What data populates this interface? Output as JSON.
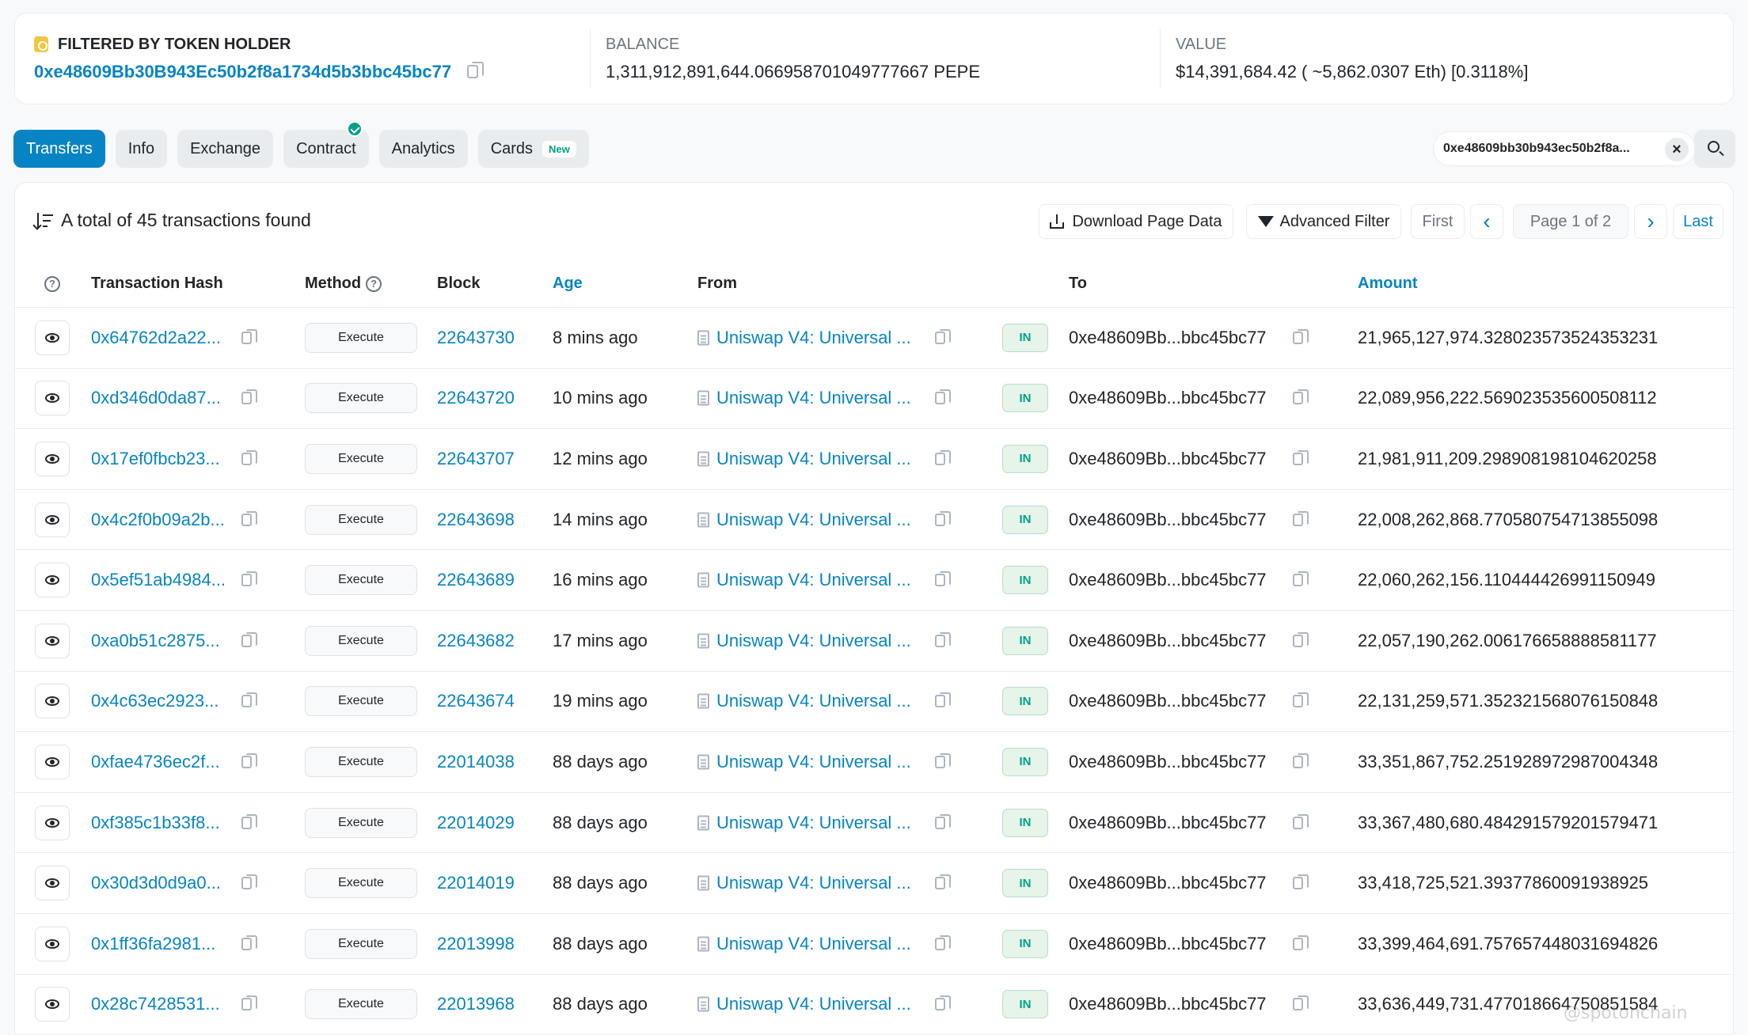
{
  "summary": {
    "filter_label": "FILTERED BY TOKEN HOLDER",
    "holder_address": "0xe48609Bb30B943Ec50b2f8a1734d5b3bbc45bc77",
    "balance_label": "BALANCE",
    "balance_value": "1,311,912,891,644.066958701049777667 PEPE",
    "value_label": "VALUE",
    "value_value": "$14,391,684.42 ( ~5,862.0307 Eth) [0.3118%]"
  },
  "tabs": [
    {
      "label": "Transfers",
      "active": true
    },
    {
      "label": "Info"
    },
    {
      "label": "Exchange"
    },
    {
      "label": "Contract",
      "verified": true
    },
    {
      "label": "Analytics"
    },
    {
      "label": "Cards",
      "badge": "New"
    }
  ],
  "filter_chip": {
    "text": "0xe48609bb30b943ec50b2f8a..."
  },
  "toolbar": {
    "total_text": "A total of 45 transactions found",
    "download_label": "Download Page Data",
    "advanced_filter_label": "Advanced Filter",
    "first_label": "First",
    "prev_label": "‹",
    "page_label": "Page 1 of 2",
    "next_label": "›",
    "last_label": "Last"
  },
  "table": {
    "headers": {
      "hash": "Transaction Hash",
      "method": "Method",
      "block": "Block",
      "age": "Age",
      "from": "From",
      "to": "To",
      "amount": "Amount"
    },
    "rows": [
      {
        "hash": "0x64762d2a22...",
        "method": "Execute",
        "block": "22643730",
        "age": "8 mins ago",
        "from": "Uniswap V4: Universal ...",
        "dir": "IN",
        "to": "0xe48609Bb...bbc45bc77",
        "amount": "21,965,127,974.328023573524353231"
      },
      {
        "hash": "0xd346d0da87...",
        "method": "Execute",
        "block": "22643720",
        "age": "10 mins ago",
        "from": "Uniswap V4: Universal ...",
        "dir": "IN",
        "to": "0xe48609Bb...bbc45bc77",
        "amount": "22,089,956,222.569023535600508112"
      },
      {
        "hash": "0x17ef0fbcb23...",
        "method": "Execute",
        "block": "22643707",
        "age": "12 mins ago",
        "from": "Uniswap V4: Universal ...",
        "dir": "IN",
        "to": "0xe48609Bb...bbc45bc77",
        "amount": "21,981,911,209.298908198104620258"
      },
      {
        "hash": "0x4c2f0b09a2b...",
        "method": "Execute",
        "block": "22643698",
        "age": "14 mins ago",
        "from": "Uniswap V4: Universal ...",
        "dir": "IN",
        "to": "0xe48609Bb...bbc45bc77",
        "amount": "22,008,262,868.770580754713855098"
      },
      {
        "hash": "0x5ef51ab4984...",
        "method": "Execute",
        "block": "22643689",
        "age": "16 mins ago",
        "from": "Uniswap V4: Universal ...",
        "dir": "IN",
        "to": "0xe48609Bb...bbc45bc77",
        "amount": "22,060,262,156.110444426991150949"
      },
      {
        "hash": "0xa0b51c2875...",
        "method": "Execute",
        "block": "22643682",
        "age": "17 mins ago",
        "from": "Uniswap V4: Universal ...",
        "dir": "IN",
        "to": "0xe48609Bb...bbc45bc77",
        "amount": "22,057,190,262.006176658888581177"
      },
      {
        "hash": "0x4c63ec2923...",
        "method": "Execute",
        "block": "22643674",
        "age": "19 mins ago",
        "from": "Uniswap V4: Universal ...",
        "dir": "IN",
        "to": "0xe48609Bb...bbc45bc77",
        "amount": "22,131,259,571.352321568076150848"
      },
      {
        "hash": "0xfae4736ec2f...",
        "method": "Execute",
        "block": "22014038",
        "age": "88 days ago",
        "from": "Uniswap V4: Universal ...",
        "dir": "IN",
        "to": "0xe48609Bb...bbc45bc77",
        "amount": "33,351,867,752.251928972987004348"
      },
      {
        "hash": "0xf385c1b33f8...",
        "method": "Execute",
        "block": "22014029",
        "age": "88 days ago",
        "from": "Uniswap V4: Universal ...",
        "dir": "IN",
        "to": "0xe48609Bb...bbc45bc77",
        "amount": "33,367,480,680.484291579201579471"
      },
      {
        "hash": "0x30d3d0d9a0...",
        "method": "Execute",
        "block": "22014019",
        "age": "88 days ago",
        "from": "Uniswap V4: Universal ...",
        "dir": "IN",
        "to": "0xe48609Bb...bbc45bc77",
        "amount": "33,418,725,521.39377860091938925"
      },
      {
        "hash": "0x1ff36fa2981...",
        "method": "Execute",
        "block": "22013998",
        "age": "88 days ago",
        "from": "Uniswap V4: Universal ...",
        "dir": "IN",
        "to": "0xe48609Bb...bbc45bc77",
        "amount": "33,399,464,691.757657448031694826"
      },
      {
        "hash": "0x28c7428531...",
        "method": "Execute",
        "block": "22013968",
        "age": "88 days ago",
        "from": "Uniswap V4: Universal ...",
        "dir": "IN",
        "to": "0xe48609Bb...bbc45bc77",
        "amount": "33,636,449,731.477018664750851584"
      }
    ]
  },
  "watermark": "@spotonchain"
}
